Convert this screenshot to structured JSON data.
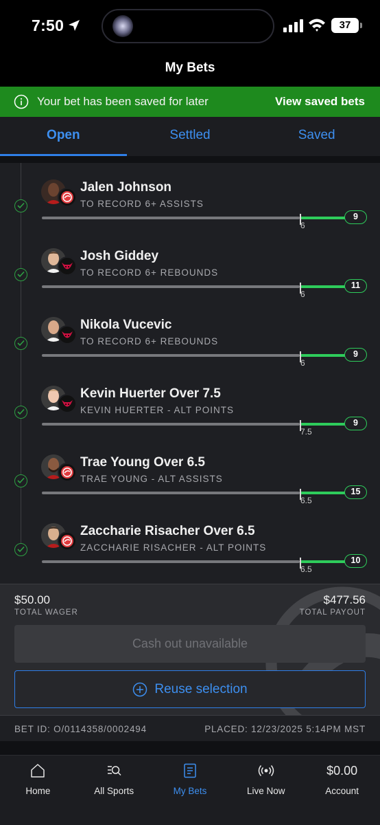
{
  "status_bar": {
    "time": "7:50",
    "battery": "37"
  },
  "header": {
    "title": "My Bets"
  },
  "banner": {
    "message": "Your bet has been saved for later",
    "link": "View saved bets"
  },
  "tabs": [
    {
      "label": "Open",
      "active": true
    },
    {
      "label": "Settled",
      "active": false
    },
    {
      "label": "Saved",
      "active": false
    }
  ],
  "legs": [
    {
      "title": "Jalen Johnson",
      "subtitle": "TO RECORD 6+ ASSISTS",
      "target": "6",
      "current": "9",
      "team": "hawks"
    },
    {
      "title": "Josh Giddey",
      "subtitle": "TO RECORD 6+ REBOUNDS",
      "target": "6",
      "current": "11",
      "team": "bulls"
    },
    {
      "title": "Nikola Vucevic",
      "subtitle": "TO RECORD 6+ REBOUNDS",
      "target": "6",
      "current": "9",
      "team": "bulls"
    },
    {
      "title": "Kevin Huerter Over 7.5",
      "subtitle": "KEVIN HUERTER - ALT POINTS",
      "target": "7.5",
      "current": "9",
      "team": "bulls"
    },
    {
      "title": "Trae Young Over 6.5",
      "subtitle": "TRAE YOUNG - ALT ASSISTS",
      "target": "6.5",
      "current": "15",
      "team": "hawks"
    },
    {
      "title": "Zaccharie Risacher Over 6.5",
      "subtitle": "ZACCHARIE RISACHER - ALT POINTS",
      "target": "6.5",
      "current": "10",
      "team": "hawks"
    }
  ],
  "summary": {
    "wager_amount": "$50.00",
    "wager_label": "TOTAL WAGER",
    "payout_amount": "$477.56",
    "payout_label": "TOTAL PAYOUT",
    "cashout_label": "Cash out unavailable",
    "reuse_label": "Reuse selection",
    "bet_id": "BET ID: O/0114358/0002494",
    "placed": "PLACED: 12/23/2025 5:14PM MST"
  },
  "nav": [
    {
      "label": "Home",
      "icon": "home-icon",
      "active": false
    },
    {
      "label": "All Sports",
      "icon": "all-sports-icon",
      "active": false
    },
    {
      "label": "My Bets",
      "icon": "my-bets-icon",
      "active": true
    },
    {
      "label": "Live Now",
      "icon": "live-now-icon",
      "active": false
    },
    {
      "label": "Account",
      "icon": "account",
      "balance": "$0.00",
      "active": false
    }
  ],
  "colors": {
    "accent": "#3d8ff0",
    "success": "#2ecc5b",
    "banner": "#1e8a1e",
    "panel": "#1e1f23"
  }
}
